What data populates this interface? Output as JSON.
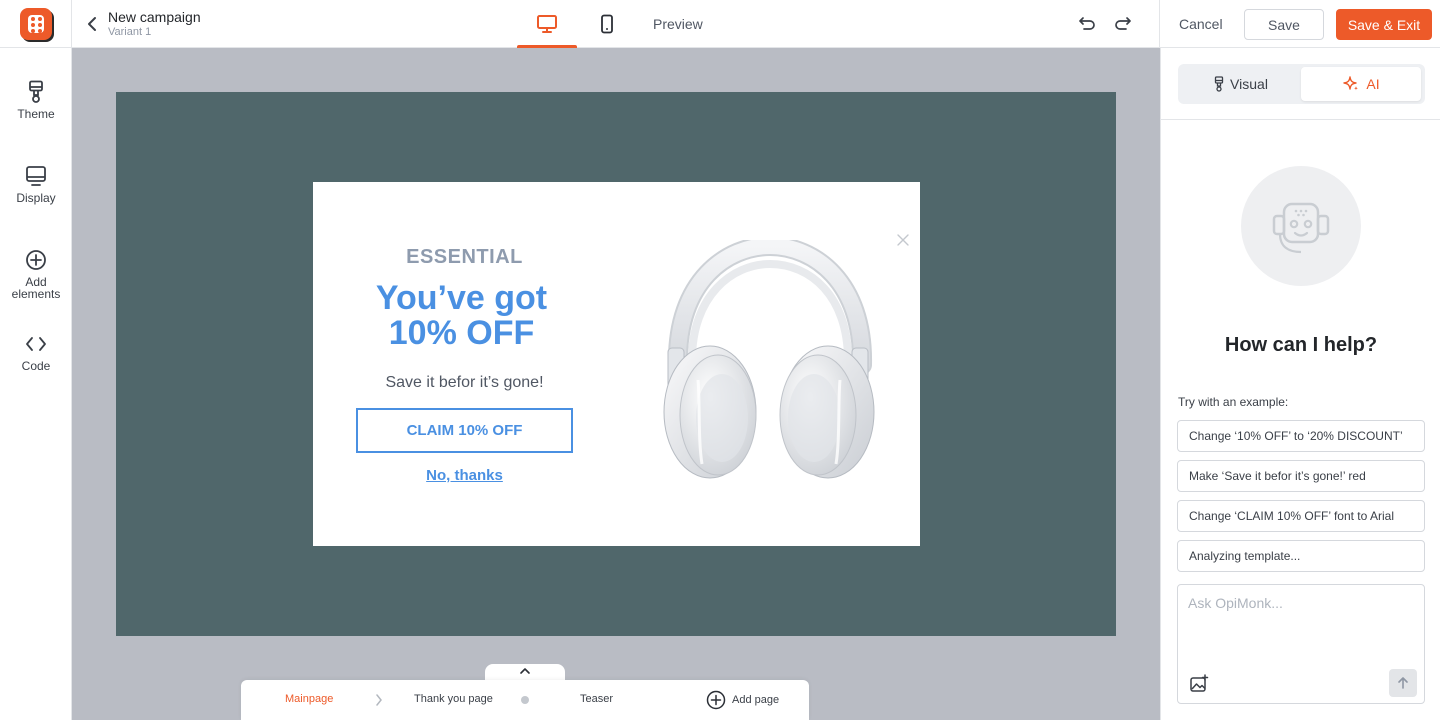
{
  "header": {
    "campaign_title": "New campaign",
    "variant": "Variant 1",
    "preview_label": "Preview",
    "cancel_label": "Cancel",
    "save_label": "Save",
    "save_exit_label": "Save & Exit",
    "active_device": "desktop"
  },
  "sidebar": {
    "items": [
      {
        "label": "Theme",
        "icon": "brush-icon"
      },
      {
        "label": "Display",
        "icon": "monitor-icon"
      },
      {
        "label": "Add elements",
        "icon": "plus-circle-icon"
      },
      {
        "label": "Code",
        "icon": "code-icon"
      }
    ]
  },
  "popup": {
    "eyebrow": "ESSENTIAL",
    "headline_line1": "You’ve got",
    "headline_line2": "10% OFF",
    "subline": "Save it befor it’s gone!",
    "cta_label": "CLAIM 10% OFF",
    "decline_label": "No, thanks",
    "image": "headphones-image"
  },
  "pages": {
    "items": [
      {
        "label": "Mainpage",
        "active": true
      },
      {
        "label": "Thank you page",
        "active": false
      },
      {
        "label": "Teaser",
        "active": false
      }
    ],
    "add_label": "Add page"
  },
  "panel": {
    "tabs": [
      {
        "label": "Visual",
        "icon": "brush-icon"
      },
      {
        "label": "AI",
        "icon": "sparkle-icon",
        "active": true
      }
    ],
    "title": "How can I help?",
    "try_label": "Try with an example:",
    "examples": [
      "Change ‘10% OFF’ to ‘20% DISCOUNT’",
      "Make ‘Save it befor it’s gone!’ red",
      "Change ‘CLAIM 10% OFF’ font to Arial",
      "Analyzing template..."
    ],
    "ask_placeholder": "Ask OpiMonk..."
  },
  "colors": {
    "accent": "#ED5A29",
    "popup_blue": "#4A90E2",
    "stage_bg": "#50676B",
    "canvas_bg": "#B9BCC4"
  }
}
